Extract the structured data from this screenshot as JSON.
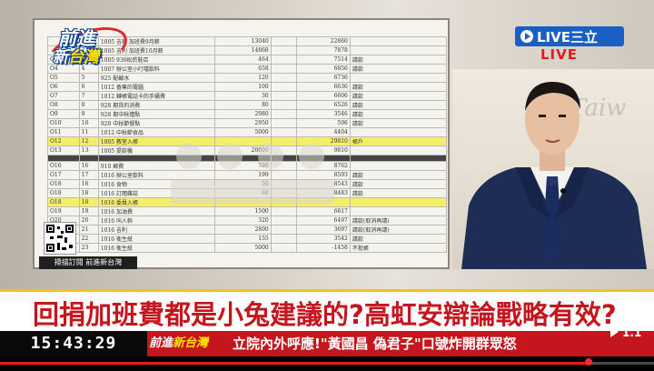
{
  "program_logo": {
    "line1": "前進",
    "line2a": "新",
    "line2b": "台灣"
  },
  "live_badge": {
    "label": "LIVE三立"
  },
  "live_text": "LIVE",
  "qr_caption": "掃描訂閱 前進新台灣",
  "document": {
    "rows": [
      {
        "code": "",
        "id": "1",
        "desc": "1005 吉利 加班費9月薪",
        "num": "13040",
        "num2": "22860",
        "note": "",
        "style": ""
      },
      {
        "code": "",
        "id": "2",
        "desc": "1005 吉利 加班費10月薪",
        "num": "14868",
        "num2": "7878",
        "note": "",
        "style": ""
      },
      {
        "code": "O3",
        "id": "3",
        "desc": "1005 930松菸鞋店",
        "num": "464",
        "num2": "7514",
        "note": "請款",
        "style": ""
      },
      {
        "code": "O4",
        "id": "4",
        "desc": "1007 辦公室小叮噹飲料",
        "num": "658",
        "num2": "6856",
        "note": "請款",
        "style": ""
      },
      {
        "code": "O5",
        "id": "5",
        "desc": "925 配鹼水",
        "num": "120",
        "num2": "6736",
        "note": "",
        "style": ""
      },
      {
        "code": "O6",
        "id": "6",
        "desc": "1012 香蕉的電腦",
        "num": "100",
        "num2": "6636",
        "note": "請款",
        "style": ""
      },
      {
        "code": "O7",
        "id": "7",
        "desc": "1012 轉帳電話卡的手續費",
        "num": "30",
        "num2": "6606",
        "note": "請款",
        "style": ""
      },
      {
        "code": "O8",
        "id": "8",
        "desc": "928 期貨的消費",
        "num": "80",
        "num2": "6526",
        "note": "請款",
        "style": ""
      },
      {
        "code": "O9",
        "id": "9",
        "desc": "928 期中秋禮點",
        "num": "2980",
        "num2": "3546",
        "note": "請款",
        "style": ""
      },
      {
        "code": "O10",
        "id": "10",
        "desc": "928 中秋節餐點",
        "num": "2950",
        "num2": "596",
        "note": "請款",
        "style": ""
      },
      {
        "code": "O11",
        "id": "11",
        "desc": "1012 中秋節食品",
        "num": "5000",
        "num2": "4404",
        "note": "",
        "style": ""
      },
      {
        "code": "O12",
        "id": "12",
        "desc": "1005 教室入帳",
        "num": "",
        "num2": "29810",
        "note": "帳戶",
        "style": "hl"
      },
      {
        "code": "O13",
        "id": "13",
        "desc": "1005 提款機",
        "num": "20000",
        "num2": "9810",
        "note": "",
        "style": ""
      },
      {
        "code": "",
        "id": "",
        "desc": "",
        "num": "",
        "num2": "",
        "note": "",
        "style": "dark"
      },
      {
        "code": "O16",
        "id": "16",
        "desc": "910 郵費",
        "num": "780",
        "num2": "8762",
        "note": "",
        "style": ""
      },
      {
        "code": "O17",
        "id": "17",
        "desc": "1016 辦公室飲料",
        "num": "199",
        "num2": "8593",
        "note": "請款",
        "style": ""
      },
      {
        "code": "O18",
        "id": "18",
        "desc": "1016 食物",
        "num": "50",
        "num2": "8543",
        "note": "請款",
        "style": ""
      },
      {
        "code": "O18",
        "id": "18",
        "desc": "1016 訂閱雜誌",
        "num": "60",
        "num2": "8483",
        "note": "請款",
        "style": ""
      },
      {
        "code": "O18",
        "id": "18",
        "desc": "1016 委員入帳",
        "num": "",
        "num2": "",
        "note": "",
        "style": "hl"
      },
      {
        "code": "O19",
        "id": "19",
        "desc": "1016 加油費",
        "num": "1500",
        "num2": "6817",
        "note": "",
        "style": ""
      },
      {
        "code": "O20",
        "id": "20",
        "desc": "1016 叫人幹",
        "num": "320",
        "num2": "6497",
        "note": "請款(取消再請)",
        "style": ""
      },
      {
        "code": "O21",
        "id": "21",
        "desc": "1016 吉利",
        "num": "2800",
        "num2": "3697",
        "note": "請款(取消再請)",
        "style": ""
      },
      {
        "code": "O22",
        "id": "22",
        "desc": "1016 衛生紙",
        "num": "155",
        "num2": "3542",
        "note": "請款",
        "style": ""
      },
      {
        "code": "O23",
        "id": "23",
        "desc": "1016 衛生紙",
        "num": "5000",
        "num2": "-1458",
        "note": "不批帳",
        "style": ""
      }
    ]
  },
  "studio_wall_text": "Taiw",
  "headline": "回捐加班費都是小兔建議的?高虹安辯論戰略有效?",
  "clock": "15:43:29",
  "ticker_logo": {
    "a": "前進",
    "b": "新台灣"
  },
  "ticker_text": "立院內外呼應!\"黃國昌 偽君子\"口號炸開群眾怒",
  "video": {
    "speed": "1.1",
    "progress": 0.9
  },
  "colors": {
    "red": "#c4161c",
    "blue": "#1a5fc4",
    "yellow": "#f2c31a"
  }
}
